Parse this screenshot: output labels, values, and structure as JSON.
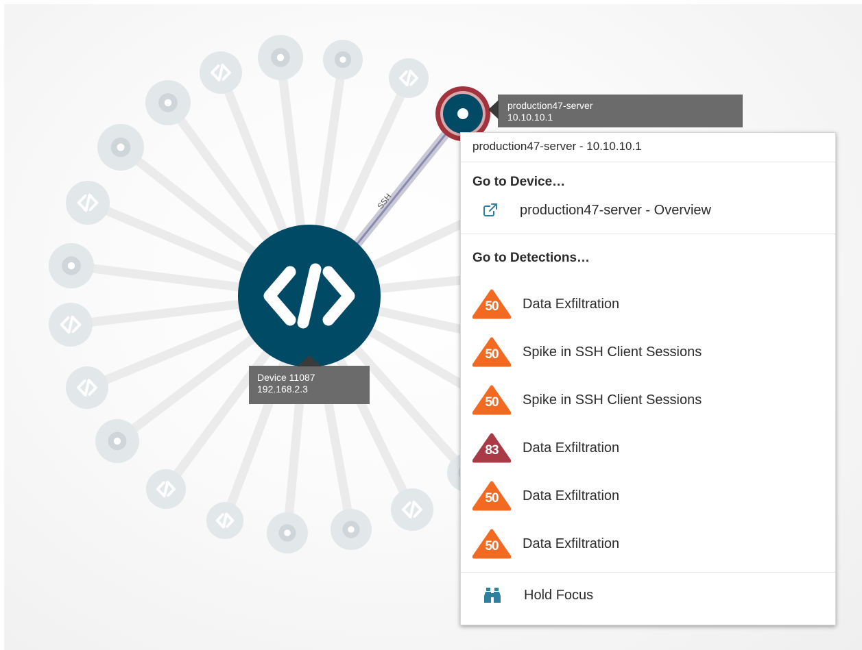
{
  "center_device": {
    "name": "Device 11087",
    "ip": "192.168.2.3",
    "icon": "code-icon"
  },
  "peer_device": {
    "name": "production47-server",
    "ip": "10.10.10.1"
  },
  "link": {
    "protocol": "SSH"
  },
  "context_menu": {
    "header": "production47-server - 10.10.10.1",
    "go_to_device": {
      "title": "Go to Device…",
      "items": [
        {
          "label": "production47-server - Overview",
          "icon": "external-link-icon"
        }
      ]
    },
    "go_to_detections": {
      "title": "Go to Detections…",
      "items": [
        {
          "score": "50",
          "label": "Data Exfiltration",
          "color": "#f26a21"
        },
        {
          "score": "50",
          "label": "Spike in SSH Client Sessions",
          "color": "#f26a21"
        },
        {
          "score": "50",
          "label": "Spike in SSH Client Sessions",
          "color": "#f26a21"
        },
        {
          "score": "83",
          "label": "Data Exfiltration",
          "color": "#a93a46"
        },
        {
          "score": "50",
          "label": "Data Exfiltration",
          "color": "#f26a21"
        },
        {
          "score": "50",
          "label": "Data Exfiltration",
          "color": "#f26a21"
        }
      ]
    },
    "hold_focus": {
      "label": "Hold Focus",
      "icon": "binoculars-icon"
    }
  },
  "colors": {
    "node_dark": "#004a66",
    "node_faded": "#e2e7ea",
    "highlight_ring": "#a2323c",
    "accent_icon": "#2f7fa0"
  }
}
